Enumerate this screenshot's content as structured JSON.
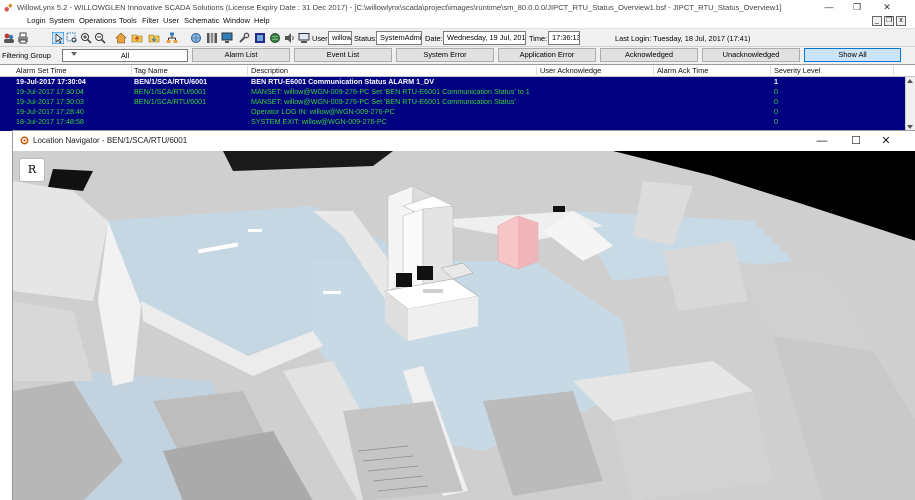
{
  "window": {
    "title": "WillowLynx 5.2 - WILLOWGLEN Innovative SCADA Solutions (License Expiry Date : 31 Dec 2017) - [C:\\willowlynx\\scada\\project\\images\\runtime\\sm_80.0.0.0/JIPCT_RTU_Status_Overview1.bsf - JIPCT_RTU_Status_Overview1]",
    "minimize": "—",
    "restore": "❐",
    "close": "✕"
  },
  "menu": {
    "items": [
      "Login",
      "System",
      "Operations",
      "Tools",
      "Filter",
      "User",
      "Schematic",
      "Window",
      "Help"
    ],
    "mdi": [
      "_",
      "❐",
      "x"
    ]
  },
  "toolbar": {
    "user_label": "User:",
    "user_value": "willow",
    "status_label": "Status:",
    "status_value": "SystemAdmin",
    "date_label": "Date:",
    "date_value": "Wednesday, 19 Jul, 2017",
    "time_label": "Time:",
    "time_value": "17:36:13",
    "last_login": "Last Login: Tuesday, 18 Jul, 2017 (17:41)"
  },
  "filter": {
    "group_label": "Filtering Group",
    "group_value": "All",
    "buttons": [
      "Alarm List",
      "Event List",
      "System Error",
      "Application Error",
      "Acknowledged",
      "Unacknowledged",
      "Show All"
    ]
  },
  "alarm_table": {
    "columns": [
      "Alarm Set Time",
      "Tag Name",
      "Description",
      "User Acknowledge",
      "Alarm Ack Time",
      "Severity Level"
    ],
    "rows": [
      {
        "time": "19-Jul-2017 17:30:04",
        "tag": "BEN/1/SCA/RTU/6001",
        "desc": "BEN RTU-E6001 Communication Status ALARM 1_DV",
        "ack": "",
        "ack_time": "",
        "severity": "1"
      },
      {
        "time": "19-Jul-2017 17:30:04",
        "tag": "BEN/1/SCA/RTU/6001",
        "desc": "MANSET: willow@WGN-009-276-PC Set 'BEN RTU-E6001 Communication Status' to 1",
        "ack": "",
        "ack_time": "",
        "severity": "0"
      },
      {
        "time": "19-Jul-2017 17:30:03",
        "tag": "BEN/1/SCA/RTU/6001",
        "desc": "MANSET: willow@WGN-009-276-PC Set 'BEN RTU-E6001 Communication Status'",
        "ack": "",
        "ack_time": "",
        "severity": "0"
      },
      {
        "time": "19-Jul-2017 17:28:40",
        "tag": "",
        "desc": "Operator LOG IN: willow@WGN-009-276-PC",
        "ack": "",
        "ack_time": "",
        "severity": "0"
      },
      {
        "time": "18-Jul-2017 17:48:58",
        "tag": "",
        "desc": "SYSTEM EXIT: willow@WGN-009-276-PC",
        "ack": "",
        "ack_time": "",
        "severity": "0"
      }
    ]
  },
  "navigator": {
    "title": "Location Navigator - BEN/1/SCA/RTU/6001",
    "reset_button": "R",
    "minimize": "—",
    "maximize": "☐",
    "close": "✕"
  },
  "colors": {
    "alarm_bg": "#000080",
    "alarm_selected_text": "#ffffff",
    "alarm_text": "#3cd23c",
    "alarm_cabinet": "#f7c6c9",
    "floor": "#c8d9e6",
    "walls": "#d9d9d9"
  }
}
